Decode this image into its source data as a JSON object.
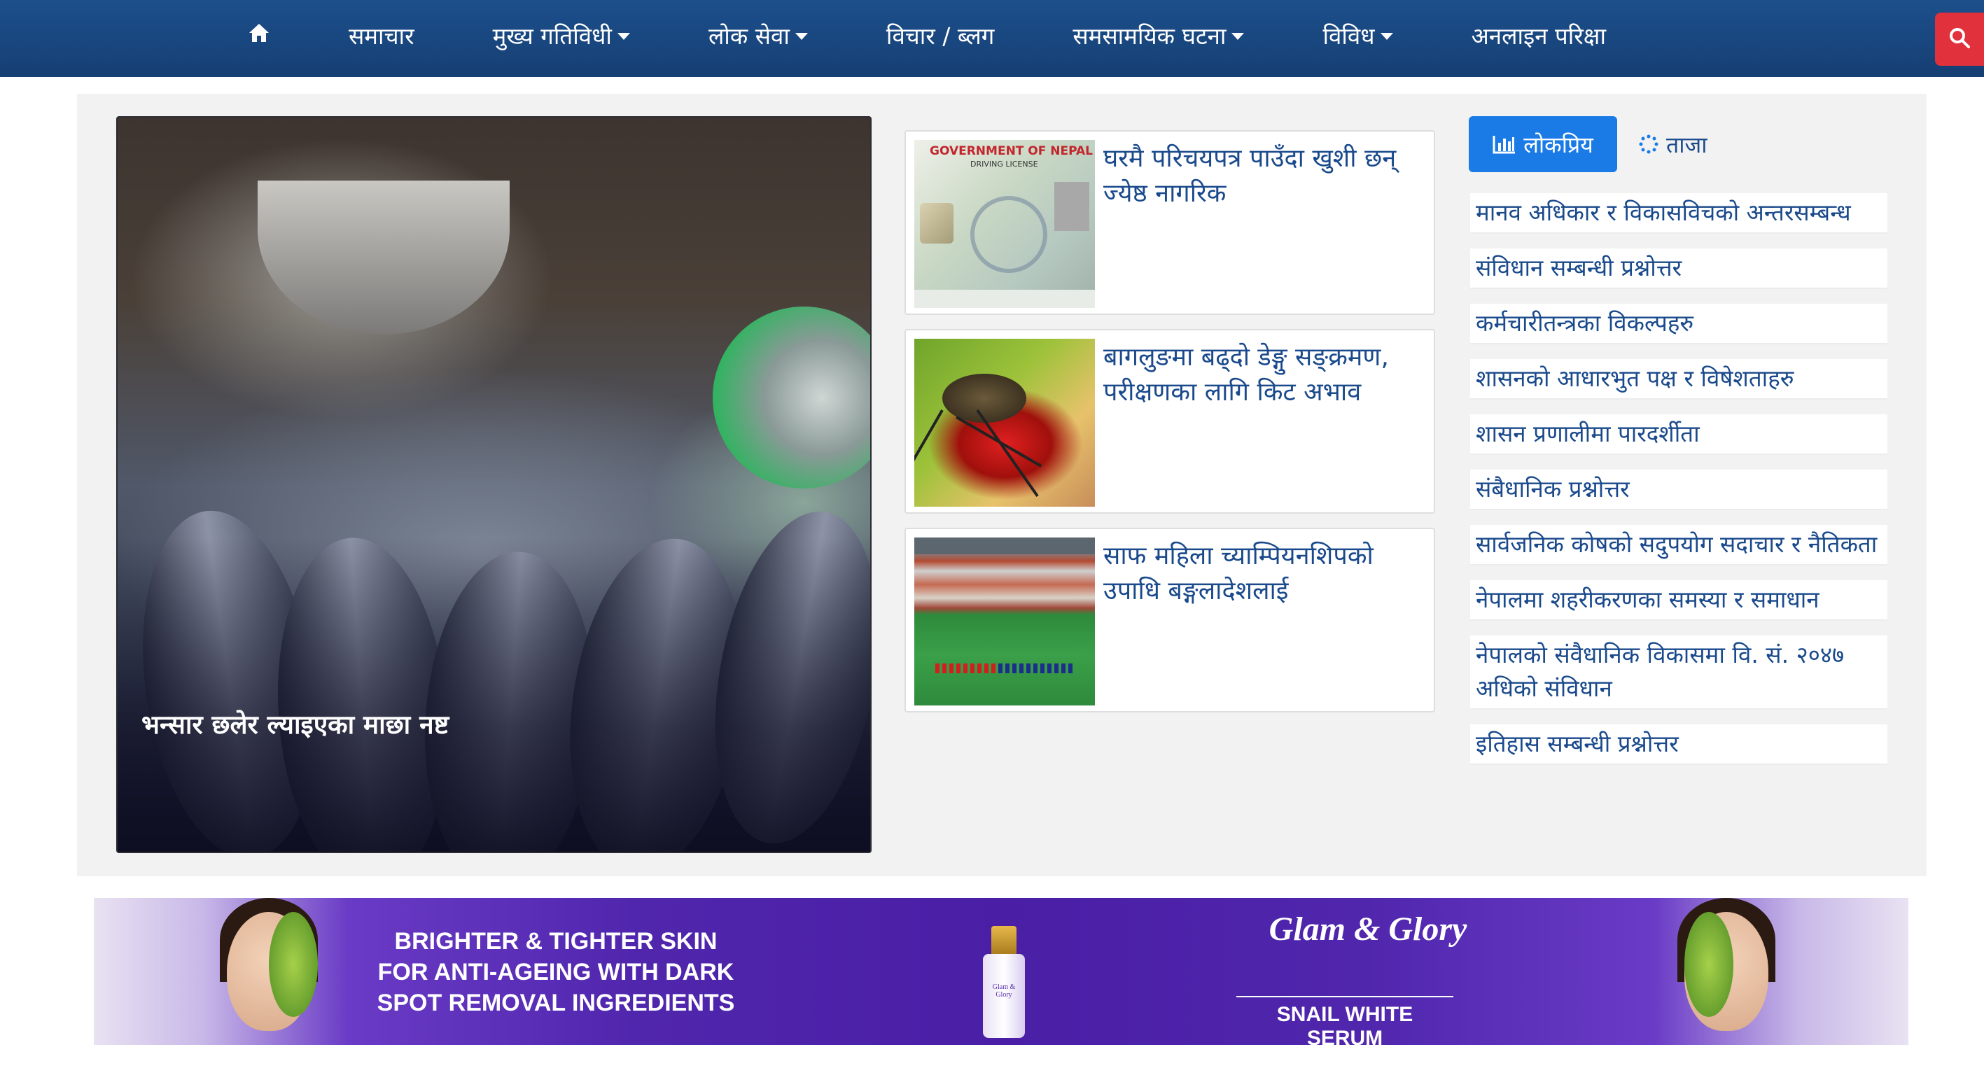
{
  "nav": {
    "home_icon": "home-icon",
    "items": [
      {
        "label": "समाचार",
        "dropdown": false
      },
      {
        "label": "मुख्य गतिविधी",
        "dropdown": true
      },
      {
        "label": "लोक सेवा",
        "dropdown": true
      },
      {
        "label": "विचार / ब्लग",
        "dropdown": false
      },
      {
        "label": "समसामयिक घटना",
        "dropdown": true
      },
      {
        "label": "विविध",
        "dropdown": true
      },
      {
        "label": "अनलाइन परिक्षा",
        "dropdown": false
      }
    ],
    "search_icon": "search-icon",
    "bg_color": "#1c4f8c",
    "search_color": "#e0313c"
  },
  "featured": {
    "title": "भन्सार छलेर ल्याइएका माछा नष्ट"
  },
  "cards": [
    {
      "title": "घरमै परिचयपत्र पाउँदा खुशी छन् ज्येष्ठ नागरिक",
      "thumb_text": "GOVERNMENT OF NEPAL",
      "thumb_sub": "DRIVING LICENSE"
    },
    {
      "title": "बागलुङमा बढ्दो डेङ्गु सङ्क्रमण, परीक्षणका लागि किट अभाव"
    },
    {
      "title": "साफ महिला च्याम्पियनशिपको उपाधि बङ्गलादेशलाई"
    }
  ],
  "sidebar": {
    "tabs": [
      {
        "label": "लोकप्रिय",
        "icon": "bar-chart-icon",
        "active": true
      },
      {
        "label": "ताजा",
        "icon": "spinner-icon",
        "active": false
      }
    ],
    "items": [
      "मानव अधिकार र विकासविचको अन्तरसम्बन्ध",
      "संविधान सम्बन्धी प्रश्नोत्तर",
      "कर्मचारीतन्त्रका विकल्पहरु",
      "शासनको आधारभुत पक्ष र विषेशताहरु",
      "शासन प्रणालीमा पारदर्शीता",
      "संबैधानिक प्रश्नोत्तर",
      "सार्वजनिक कोषको सदुपयोग सदाचार र नैतिकता",
      "नेपालमा शहरीकरणका समस्या र समाधान",
      "नेपालको संवैधानिक विकासमा वि. सं. २०४७ अधिकाे संविधान",
      "इतिहास सम्बन्धी प्रश्नोत्तर"
    ],
    "active_color": "#1a7be6",
    "link_color": "#1a4a8c"
  },
  "ad": {
    "headline": "BRIGHTER & TIGHTER SKIN FOR ANTI-AGEING WITH DARK SPOT REMOVAL INGREDIENTS",
    "bottle_label": "Glam & Glory",
    "brand": "Glam & Glory",
    "product": "SNAIL WHITE SERUM"
  }
}
